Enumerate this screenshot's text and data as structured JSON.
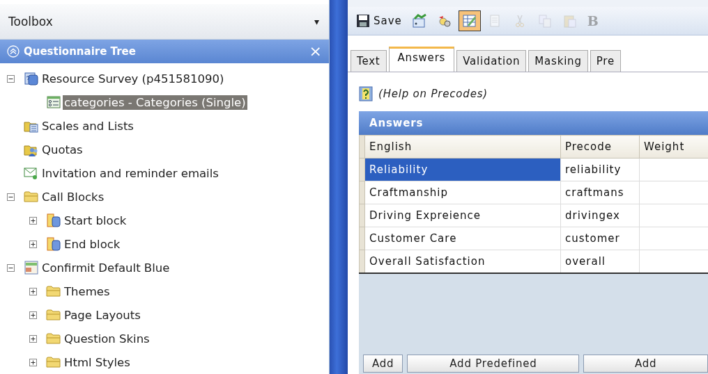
{
  "toolbox": {
    "title": "Toolbox",
    "dropdown": "▾"
  },
  "tree_panel": {
    "title": "Questionnaire Tree",
    "close": "×",
    "items": [
      {
        "label": "Resource Survey (p451581090)",
        "kind": "survey",
        "expanded": true,
        "selected": false,
        "children": [
          {
            "label": "categories - Categories (Single)",
            "kind": "question",
            "selected": true
          }
        ]
      },
      {
        "label": "Scales and Lists",
        "kind": "lists",
        "selected": false
      },
      {
        "label": "Quotas",
        "kind": "quotas",
        "selected": false
      },
      {
        "label": "Invitation and reminder emails",
        "kind": "email",
        "selected": false
      },
      {
        "label": "Call Blocks",
        "kind": "folder",
        "expanded": true,
        "selected": false,
        "children": [
          {
            "label": "Start block",
            "kind": "block",
            "expanded": false,
            "selected": false
          },
          {
            "label": "End block",
            "kind": "block",
            "expanded": false,
            "selected": false
          }
        ]
      },
      {
        "label": "Confirmit Default Blue",
        "kind": "theme",
        "expanded": true,
        "selected": false,
        "children": [
          {
            "label": "Themes",
            "kind": "folder",
            "expanded": false,
            "selected": false
          },
          {
            "label": "Page Layouts",
            "kind": "folder",
            "expanded": false,
            "selected": false
          },
          {
            "label": "Question Skins",
            "kind": "folder",
            "expanded": false,
            "selected": false
          },
          {
            "label": "Html Styles",
            "kind": "folder",
            "expanded": false,
            "selected": false
          }
        ]
      }
    ]
  },
  "toolbar": [
    {
      "kind": "save",
      "label": "Save",
      "pressed": false,
      "disabled": false
    },
    {
      "kind": "chart",
      "pressed": false,
      "disabled": false
    },
    {
      "kind": "gear",
      "pressed": false,
      "disabled": false
    },
    {
      "kind": "edit",
      "pressed": true,
      "disabled": false
    },
    {
      "kind": "page",
      "pressed": false,
      "disabled": true
    },
    {
      "kind": "cut",
      "pressed": false,
      "disabled": true
    },
    {
      "kind": "copy",
      "pressed": false,
      "disabled": true
    },
    {
      "kind": "paste",
      "pressed": false,
      "disabled": true
    },
    {
      "kind": "bold",
      "label": "B",
      "pressed": false,
      "disabled": true
    }
  ],
  "tabs": [
    {
      "label": "Text",
      "selected": false
    },
    {
      "label": "Answers",
      "selected": true
    },
    {
      "label": "Validation",
      "selected": false
    },
    {
      "label": "Masking",
      "selected": false
    },
    {
      "label": "Pre",
      "selected": false
    }
  ],
  "help_link": "(Help on Precodes)",
  "answers": {
    "title": "Answers",
    "columns": [
      "English",
      "Precode",
      "Weight"
    ],
    "rows": [
      {
        "english": "Reliability",
        "precode": "reliability",
        "selected": true
      },
      {
        "english": "Craftmanship",
        "precode": "craftmans",
        "selected": false
      },
      {
        "english": "Driving Expreience",
        "precode": "drivingex",
        "selected": false
      },
      {
        "english": "Customer Care",
        "precode": "customer",
        "selected": false
      },
      {
        "english": "Overall Satisfaction",
        "precode": "overall",
        "selected": false
      }
    ],
    "buttons": [
      "Add",
      "Add Predefined",
      "Add"
    ]
  }
}
